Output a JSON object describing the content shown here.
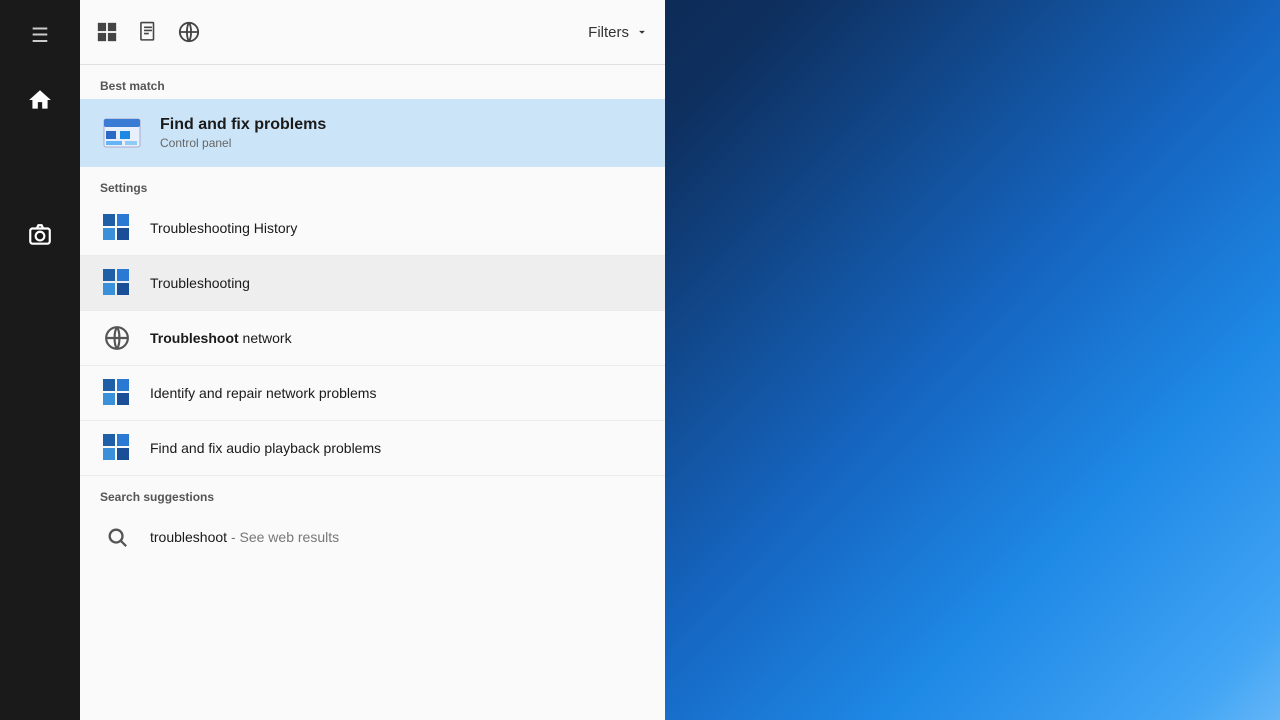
{
  "desktop": {
    "bg_description": "Windows 10 blue gradient desktop"
  },
  "sidebar": {
    "items": [
      {
        "name": "hamburger",
        "icon": "☰",
        "label": "Menu"
      },
      {
        "name": "home",
        "icon": "⌂",
        "label": "Home"
      },
      {
        "name": "camera",
        "icon": "⊙",
        "label": "Screenshot"
      }
    ]
  },
  "toolbar": {
    "icon_apps": "⊞",
    "icon_doc": "☐",
    "icon_globe": "🌐",
    "filters_label": "Filters",
    "filters_chevron": "∨"
  },
  "sections": {
    "best_match": {
      "label": "Best match",
      "item": {
        "title": "Find and fix problems",
        "subtitle": "Control panel",
        "icon": "🖥"
      }
    },
    "settings": {
      "label": "Settings",
      "items": [
        {
          "title": "Troubleshooting History",
          "icon_type": "grid"
        },
        {
          "title": "Troubleshooting",
          "icon_type": "grid",
          "active": true
        },
        {
          "title_bold": "Troubleshoot",
          "title_rest": " network",
          "icon_type": "globe"
        },
        {
          "title": "Identify and repair network problems",
          "icon_type": "grid"
        },
        {
          "title": "Find and fix audio playback problems",
          "icon_type": "grid"
        }
      ]
    },
    "search_suggestions": {
      "label": "Search suggestions",
      "items": [
        {
          "text_bold": "troubleshoot",
          "text_rest": " - See web results",
          "icon_type": "search"
        }
      ]
    }
  }
}
